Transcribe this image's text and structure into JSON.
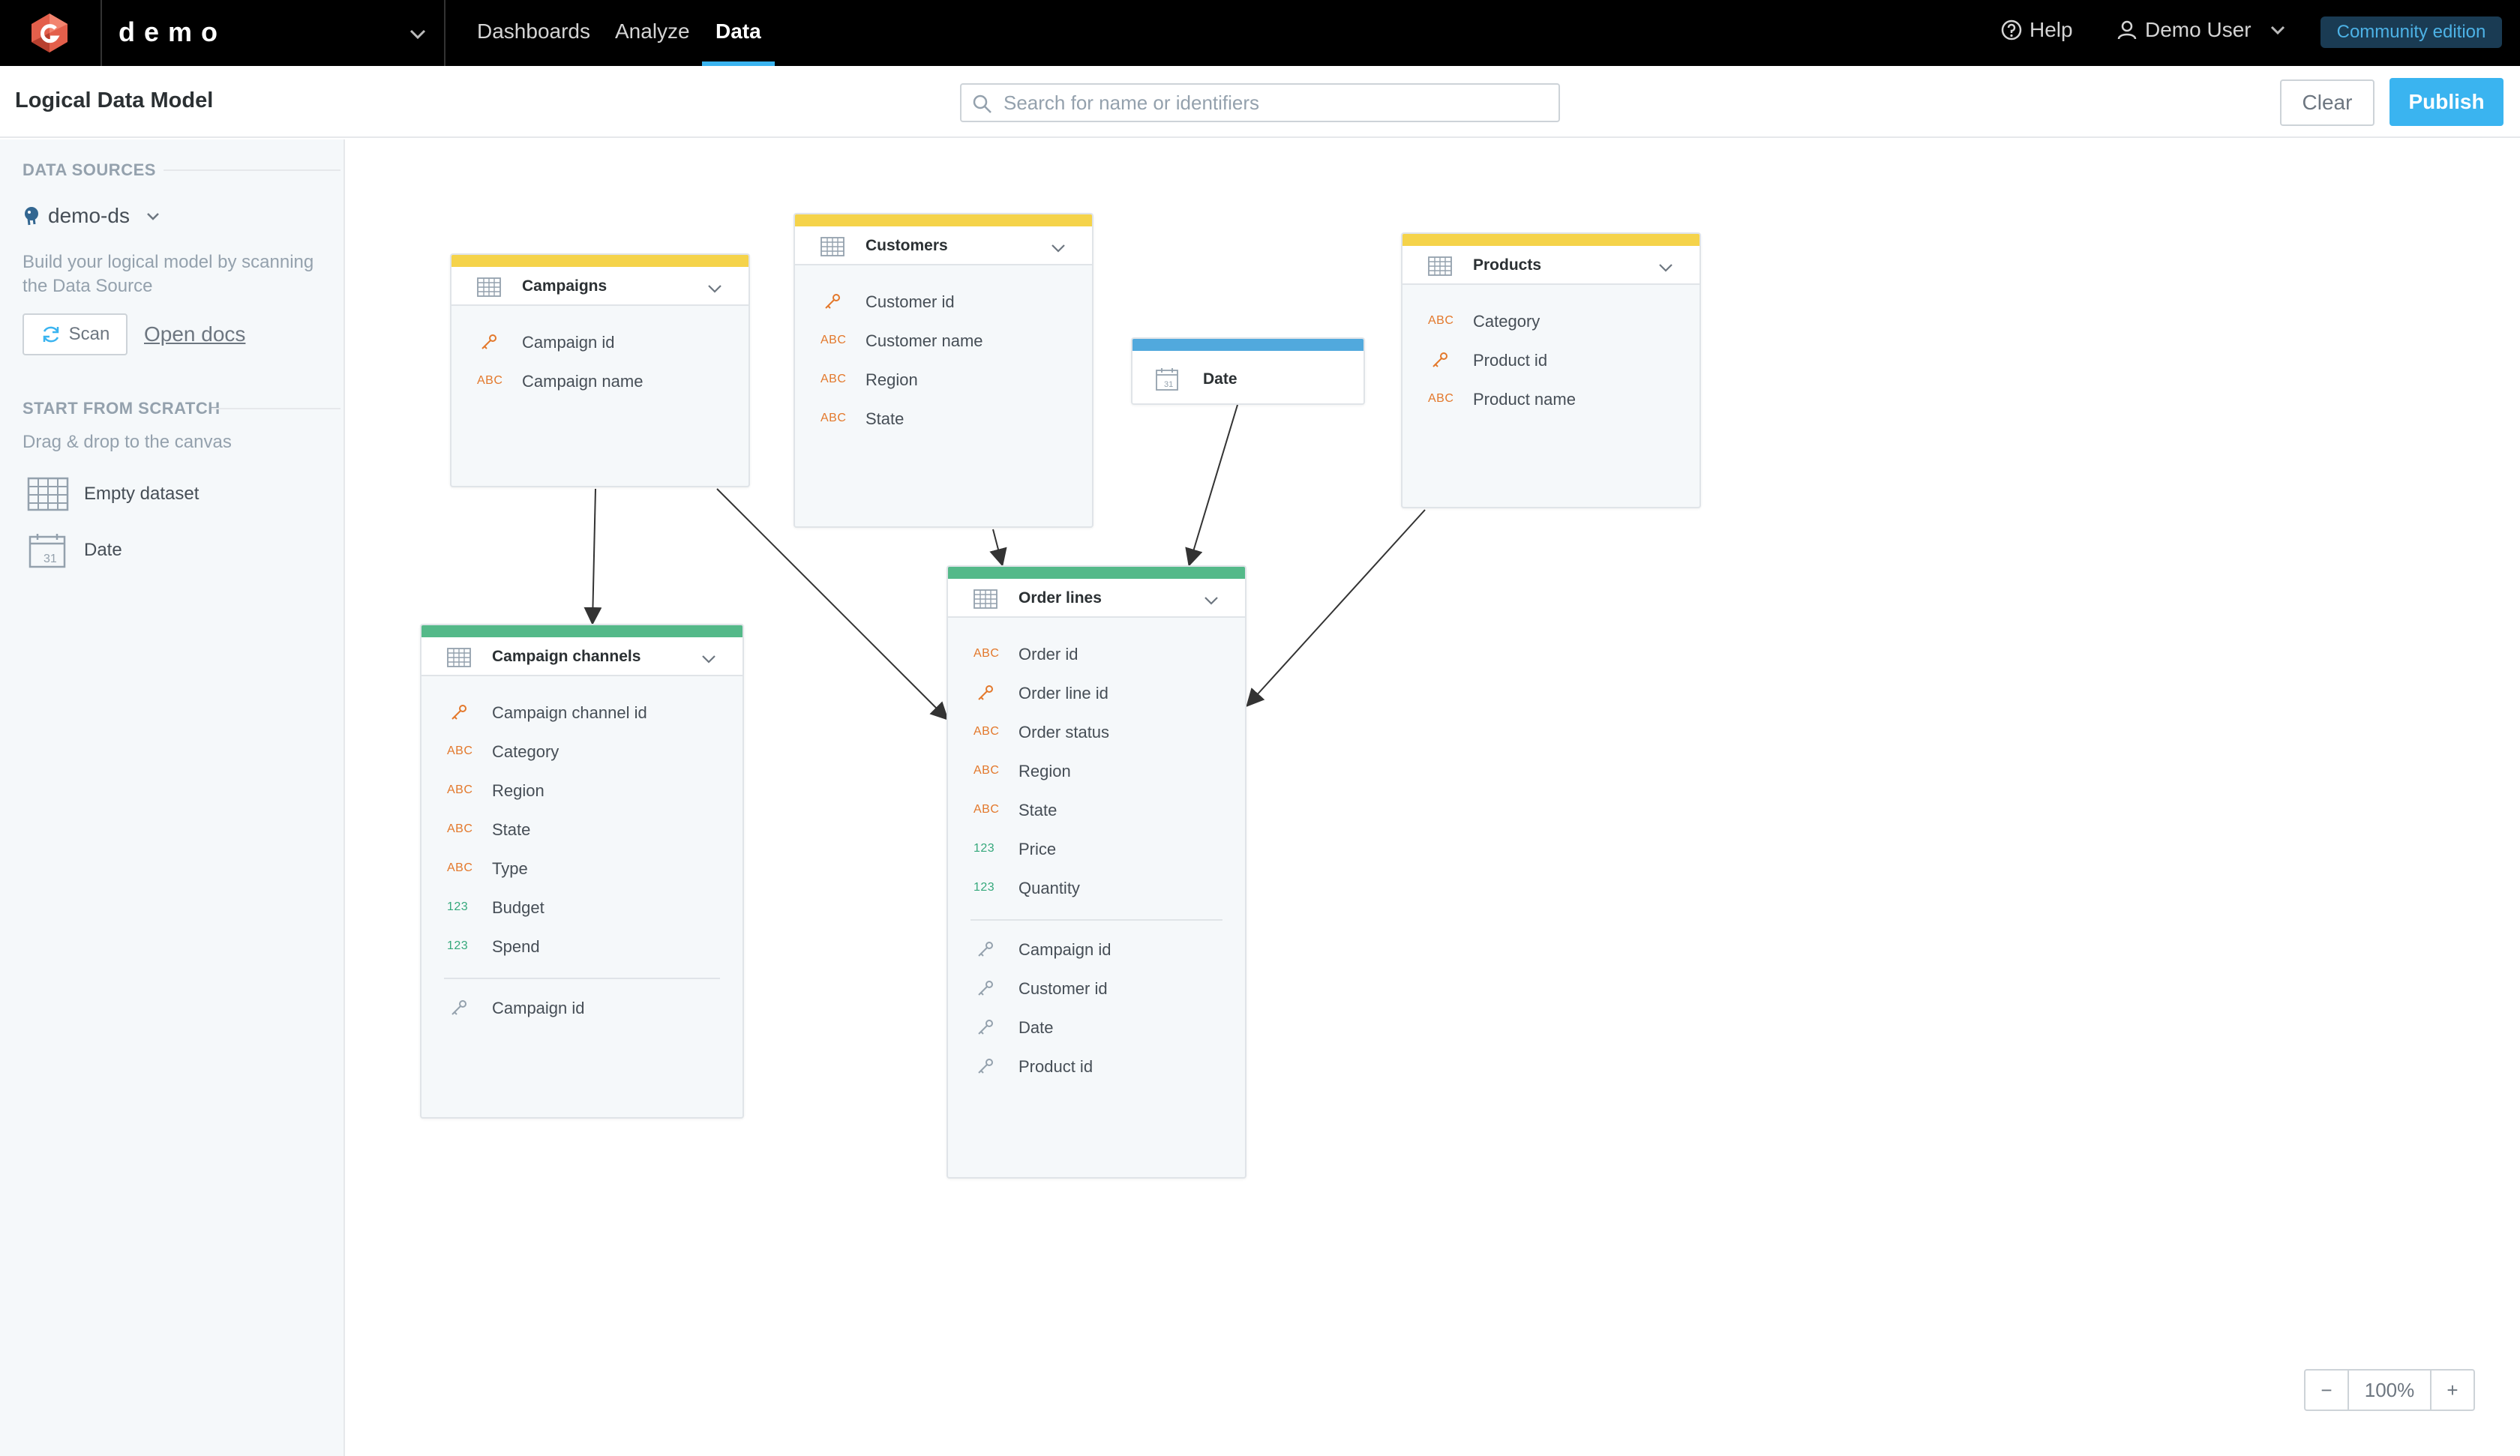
{
  "app": {
    "workspace": "demo",
    "nav": [
      "Dashboards",
      "Analyze",
      "Data"
    ],
    "help": "Help",
    "user": "Demo User",
    "edition": "Community edition"
  },
  "header": {
    "title": "Logical Data Model",
    "search_placeholder": "Search for name or identifiers",
    "search_value": "",
    "clear_label": "Clear",
    "publish_label": "Publish"
  },
  "sidebar": {
    "data_sources_label": "DATA SOURCES",
    "data_source": "demo-ds",
    "scan_hint": "Build your logical model by scanning the Data Source",
    "scan_label": "Scan",
    "open_docs_label": "Open docs",
    "scratch_label": "START FROM SCRATCH",
    "scratch_hint": "Drag & drop to the canvas",
    "scratch_items": [
      "Empty dataset",
      "Date"
    ]
  },
  "colors": {
    "attribute_dataset": "#f5d34a",
    "fact_dataset": "#54b989",
    "date_dataset": "#51a9dd",
    "accent": "#3ab4f0"
  },
  "datasets": {
    "campaigns": {
      "title": "Campaigns",
      "fields": [
        {
          "type": "key",
          "name": "Campaign id"
        },
        {
          "type": "ABC",
          "name": "Campaign name"
        }
      ]
    },
    "customers": {
      "title": "Customers",
      "fields": [
        {
          "type": "key",
          "name": "Customer id"
        },
        {
          "type": "ABC",
          "name": "Customer name"
        },
        {
          "type": "ABC",
          "name": "Region"
        },
        {
          "type": "ABC",
          "name": "State"
        }
      ]
    },
    "date": {
      "title": "Date"
    },
    "products": {
      "title": "Products",
      "fields": [
        {
          "type": "ABC",
          "name": "Category"
        },
        {
          "type": "key",
          "name": "Product id"
        },
        {
          "type": "ABC",
          "name": "Product name"
        }
      ]
    },
    "order_lines": {
      "title": "Order lines",
      "fields": [
        {
          "type": "ABC",
          "name": "Order id"
        },
        {
          "type": "key",
          "name": "Order line id"
        },
        {
          "type": "ABC",
          "name": "Order status"
        },
        {
          "type": "ABC",
          "name": "Region"
        },
        {
          "type": "ABC",
          "name": "State"
        },
        {
          "type": "123",
          "name": "Price"
        },
        {
          "type": "123",
          "name": "Quantity"
        }
      ],
      "references": [
        "Campaign id",
        "Customer id",
        "Date",
        "Product id"
      ]
    },
    "campaign_channels": {
      "title": "Campaign channels",
      "fields": [
        {
          "type": "key",
          "name": "Campaign channel id"
        },
        {
          "type": "ABC",
          "name": "Category"
        },
        {
          "type": "ABC",
          "name": "Region"
        },
        {
          "type": "ABC",
          "name": "State"
        },
        {
          "type": "ABC",
          "name": "Type"
        },
        {
          "type": "123",
          "name": "Budget"
        },
        {
          "type": "123",
          "name": "Spend"
        }
      ],
      "references": [
        "Campaign id"
      ]
    }
  },
  "zoom": {
    "minus": "−",
    "value": "100%",
    "plus": "+"
  }
}
